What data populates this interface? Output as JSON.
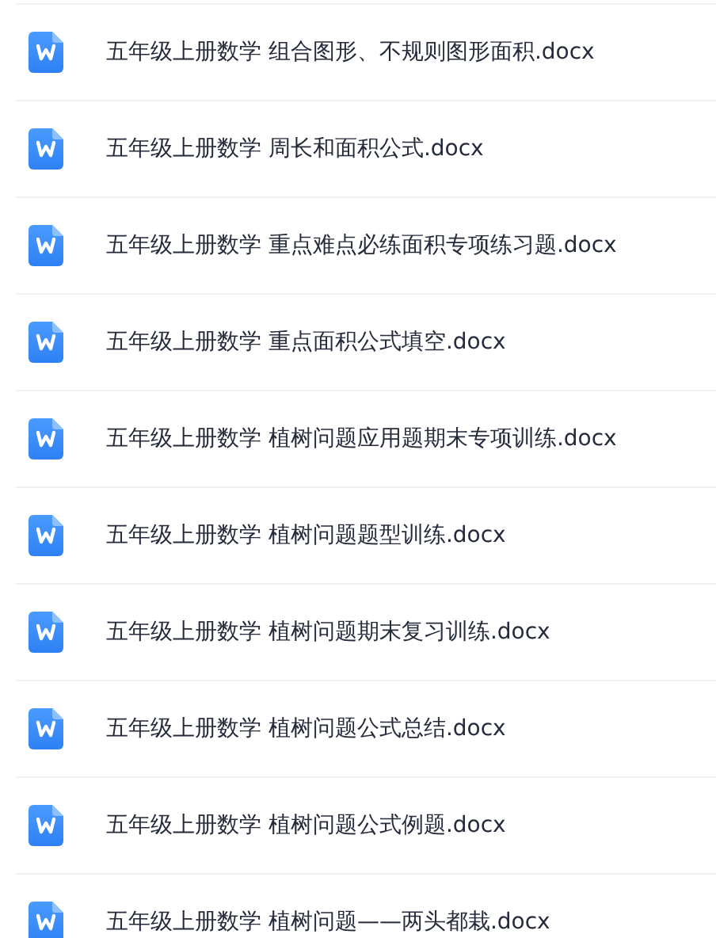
{
  "files": [
    {
      "name": "五年级上册数学 组合图形、不规则图形面积.docx"
    },
    {
      "name": "五年级上册数学 周长和面积公式.docx"
    },
    {
      "name": "五年级上册数学 重点难点必练面积专项练习题.docx"
    },
    {
      "name": "五年级上册数学 重点面积公式填空.docx"
    },
    {
      "name": "五年级上册数学 植树问题应用题期末专项训练.docx"
    },
    {
      "name": "五年级上册数学 植树问题题型训练.docx"
    },
    {
      "name": "五年级上册数学 植树问题期末复习训练.docx"
    },
    {
      "name": "五年级上册数学 植树问题公式总结.docx"
    },
    {
      "name": "五年级上册数学 植树问题公式例题.docx"
    },
    {
      "name": "五年级上册数学 植树问题——两头都栽.docx"
    }
  ]
}
